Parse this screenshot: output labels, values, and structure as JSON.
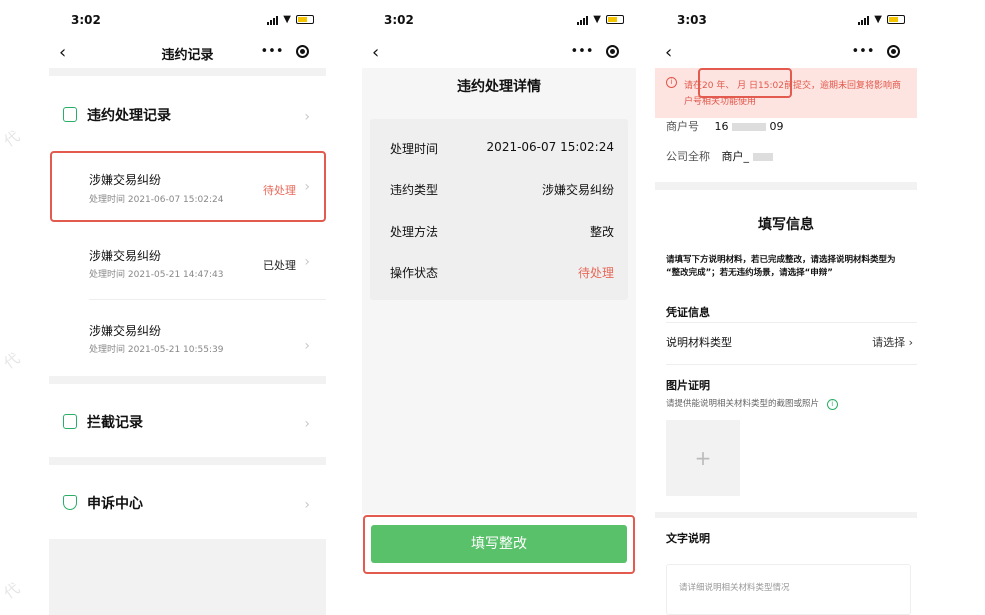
{
  "status_bar": {
    "time_1": "3:02",
    "time_2": "3:02",
    "time_3": "3:03"
  },
  "watermark": "代",
  "colors": {
    "accent_green": "#59c16a",
    "alert_red": "#e35b4f",
    "pending": "#e86a5a"
  },
  "phone1": {
    "nav_title": "违约记录",
    "section_records": "违约处理记录",
    "items": [
      {
        "title": "涉嫌交易纠纷",
        "time": "处理时间 2021-06-07 15:02:24",
        "status": "待处理"
      },
      {
        "title": "涉嫌交易纠纷",
        "time": "处理时间 2021-05-21 14:47:43",
        "status": "已处理"
      },
      {
        "title": "涉嫌交易纠纷",
        "time": "处理时间 2021-05-21 10:55:39",
        "status": ""
      }
    ],
    "section_intercept": "拦截记录",
    "section_appeal": "申诉中心"
  },
  "phone2": {
    "title": "违约处理详情",
    "rows": [
      {
        "label": "处理时间",
        "value": "2021-06-07 15:02:24"
      },
      {
        "label": "违约类型",
        "value": "涉嫌交易纠纷"
      },
      {
        "label": "处理方法",
        "value": "整改"
      },
      {
        "label": "操作状态",
        "value": "待处理"
      }
    ],
    "button": "填写整改"
  },
  "phone3": {
    "banner_line1": "请在20  年、  月  日15:02前提交，逾期未回复将影响商",
    "banner_line2": "户号相关功能使用",
    "merchant_label": "商户号",
    "merchant_value_a": "16",
    "merchant_value_b": "09",
    "company_label": "公司全称",
    "company_value": "商户_",
    "form_title": "填写信息",
    "instructions_1": "请填写下方说明材料，若已完成整改，请选择说明材料类型为",
    "instructions_2": "“整改完成”；若无违约场景，请选择“申辩”",
    "voucher_title": "凭证信息",
    "material_type_label": "说明材料类型",
    "material_type_value": "请选择",
    "image_title": "图片证明",
    "image_hint": "请提供能说明相关材料类型的截图或照片",
    "upload_plus": "+",
    "text_title": "文字说明",
    "text_placeholder": "请详细说明相关材料类型情况"
  }
}
